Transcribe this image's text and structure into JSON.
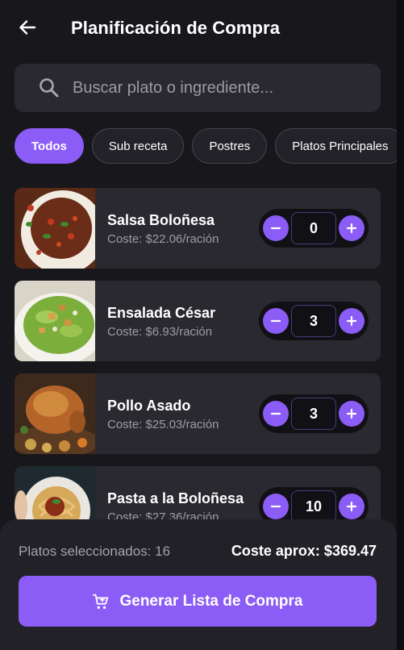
{
  "header": {
    "title": "Planificación de Compra",
    "back_icon": "arrow-left-icon"
  },
  "search": {
    "placeholder": "Buscar plato o ingrediente...",
    "value": "",
    "icon": "search-icon"
  },
  "filters": [
    {
      "label": "Todos",
      "active": true
    },
    {
      "label": "Sub receta",
      "active": false
    },
    {
      "label": "Postres",
      "active": false
    },
    {
      "label": "Platos Principales",
      "active": false
    }
  ],
  "dishes": [
    {
      "name": "Salsa Boloñesa",
      "cost": "Coste: $22.06/ración",
      "quantity": "0",
      "image": "bolognese-sauce-photo"
    },
    {
      "name": "Ensalada César",
      "cost": "Coste: $6.93/ración",
      "quantity": "3",
      "image": "caesar-salad-photo"
    },
    {
      "name": "Pollo Asado",
      "cost": "Coste: $25.03/ración",
      "quantity": "3",
      "image": "roast-chicken-photo"
    },
    {
      "name": "Pasta a la Boloñesa",
      "cost": "Coste: $27.36/ración",
      "quantity": "10",
      "image": "pasta-bolognese-photo"
    }
  ],
  "footer": {
    "selected_label": "Platos seleccionados: 16",
    "approx_cost": "Coste aprox: $369.47",
    "generate_label": "Generar Lista de Compra",
    "generate_icon": "cart-icon"
  },
  "colors": {
    "accent": "#8b5cf6",
    "background": "#18171c",
    "card": "#2a292f"
  }
}
